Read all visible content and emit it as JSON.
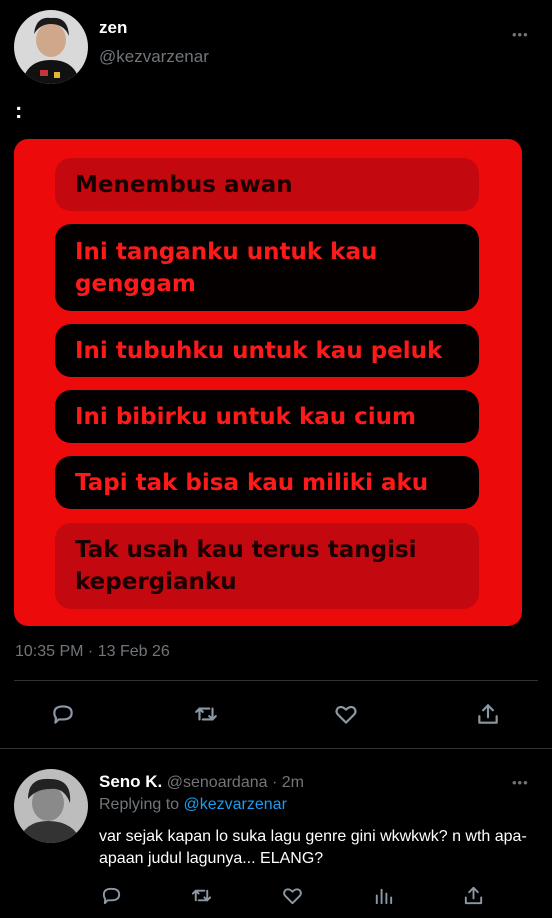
{
  "tweet": {
    "display_name": "zen",
    "handle": "@kezvarzenar",
    "text": ":",
    "lyrics": [
      {
        "text": "Menembus awan",
        "style": "red"
      },
      {
        "text": "Ini tanganku untuk kau genggam",
        "style": "dark"
      },
      {
        "text": "Ini tubuhku untuk kau peluk",
        "style": "dark"
      },
      {
        "text": "Ini bibirku untuk kau cium",
        "style": "dark"
      },
      {
        "text": "Tapi tak bisa kau miliki aku",
        "style": "dark"
      },
      {
        "text": "Tak usah kau terus tangisi kepergianku",
        "style": "red"
      }
    ],
    "timestamp": "10:35 PM · 13 Feb 26",
    "more_glyph": "•••"
  },
  "reply": {
    "display_name": "Seno K.",
    "handle": "@senoardana",
    "time": "· 2m",
    "replying_to_label": "Replying to",
    "replying_to_handle": "@kezvarzenar",
    "text": "var sejak kapan lo suka lagu genre gini wkwkwk? n wth apa-apaan judul lagunya... ELANG?",
    "more_glyph": "•••"
  },
  "colors": {
    "card": "#ec0a0a",
    "lyric_dark_text": "#ff1a1a",
    "link": "#1d9bf0",
    "muted": "#71767b"
  },
  "icons": [
    "comment-icon",
    "retweet-icon",
    "like-icon",
    "share-icon",
    "stats-icon"
  ]
}
